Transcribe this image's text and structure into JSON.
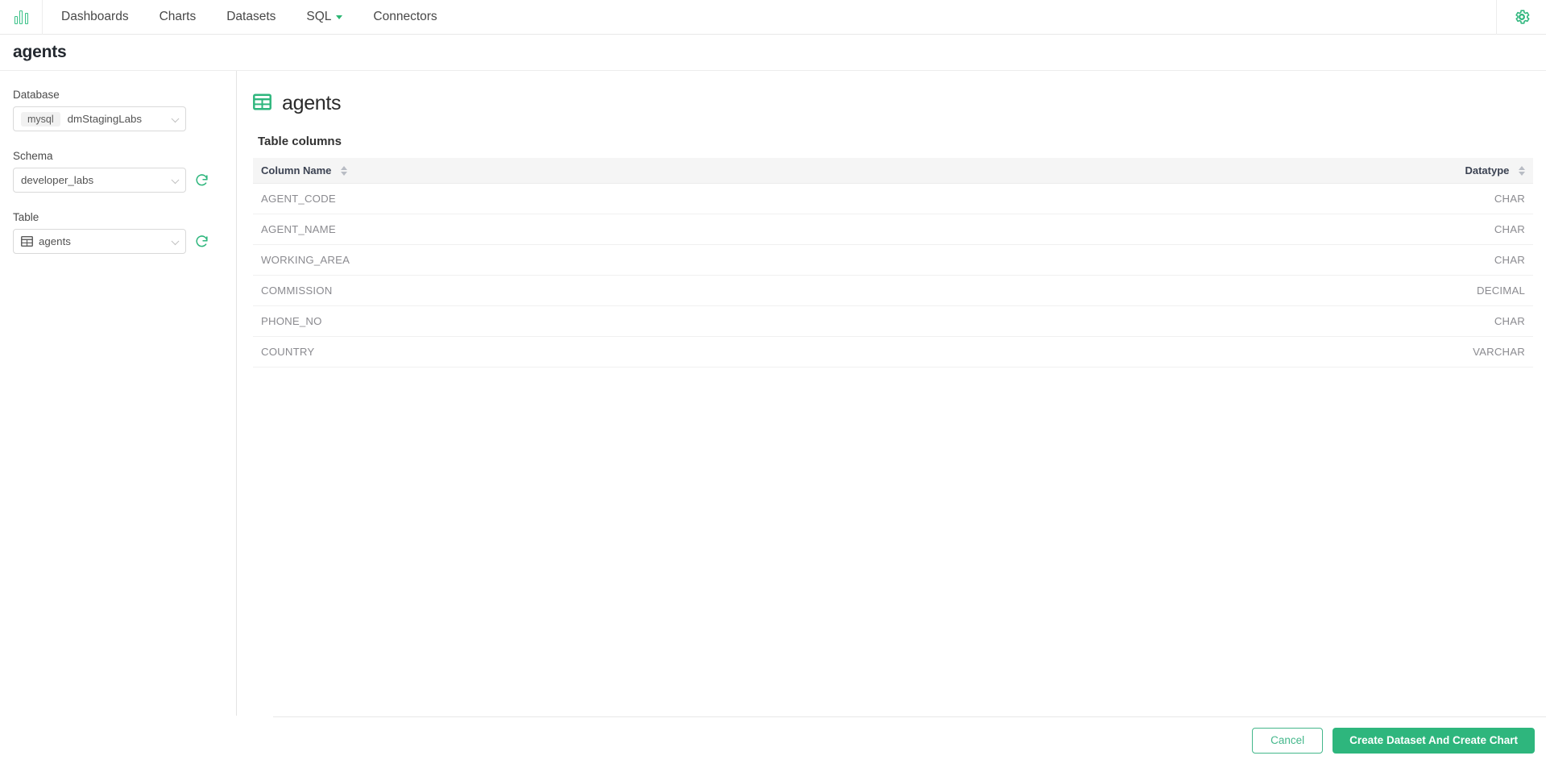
{
  "navbar": {
    "logo_icon": "superset-bar-chart-logo",
    "items": [
      {
        "label": "Dashboards",
        "icon": "",
        "has_caret": false
      },
      {
        "label": "Charts",
        "icon": "",
        "has_caret": false
      },
      {
        "label": "Datasets",
        "icon": "",
        "has_caret": false
      },
      {
        "label": "SQL",
        "icon": "chevron-down-icon",
        "has_caret": true
      },
      {
        "label": "Connectors",
        "icon": "",
        "has_caret": false
      }
    ],
    "settings_icon": "gear-icon"
  },
  "page": {
    "title": "agents"
  },
  "sidebar": {
    "database": {
      "label": "Database",
      "engine_chip": "mysql",
      "value": "dmStagingLabs",
      "caret_icon": "chevron-down-icon"
    },
    "schema": {
      "label": "Schema",
      "value": "developer_labs",
      "caret_icon": "chevron-down-icon",
      "refresh_icon": "refresh-icon"
    },
    "table": {
      "label": "Table",
      "value": "agents",
      "table_icon": "table-icon",
      "caret_icon": "chevron-down-icon",
      "refresh_icon": "refresh-icon"
    }
  },
  "main": {
    "dataset_icon": "table-icon",
    "dataset_name": "agents",
    "section_label": "Table columns",
    "table": {
      "headers": [
        {
          "label": "Column Name",
          "sort_icon": "sort-carets-icon"
        },
        {
          "label": "Datatype",
          "sort_icon": "sort-carets-icon"
        }
      ],
      "rows": [
        {
          "column_name": "AGENT_CODE",
          "datatype": "CHAR"
        },
        {
          "column_name": "AGENT_NAME",
          "datatype": "CHAR"
        },
        {
          "column_name": "WORKING_AREA",
          "datatype": "CHAR"
        },
        {
          "column_name": "COMMISSION",
          "datatype": "DECIMAL"
        },
        {
          "column_name": "PHONE_NO",
          "datatype": "CHAR"
        },
        {
          "column_name": "COUNTRY",
          "datatype": "VARCHAR"
        }
      ]
    }
  },
  "footer": {
    "cancel_label": "Cancel",
    "create_label": "Create Dataset And Create Chart"
  },
  "colors": {
    "brand_green": "#2eb67d",
    "accent_green": "#44b78b",
    "header_bg": "#f5f5f5",
    "text_dark": "#323232",
    "text_muted": "#8b8b90"
  }
}
